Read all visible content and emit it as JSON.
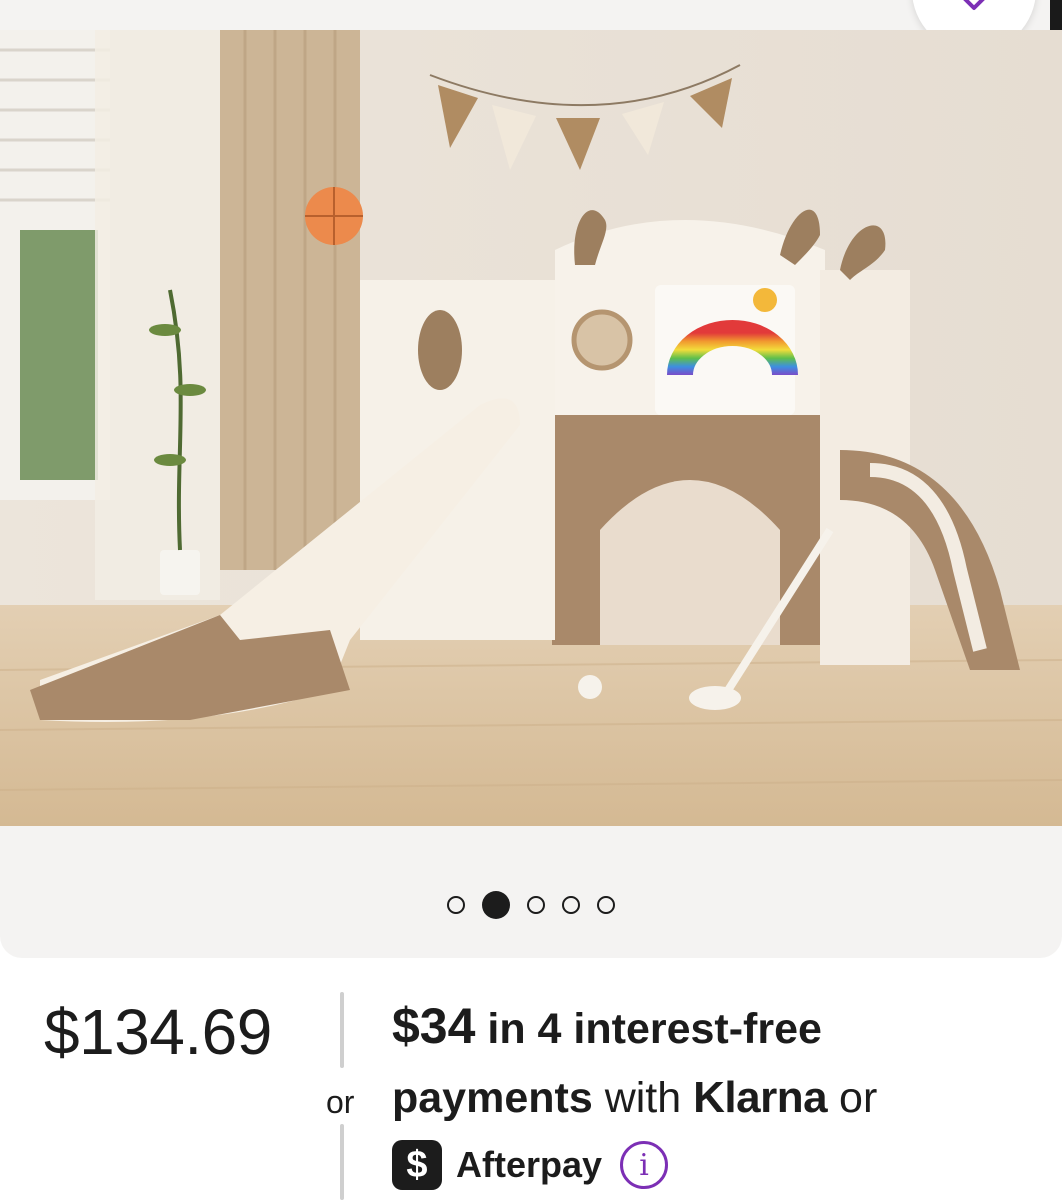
{
  "gallery": {
    "image_alt": "Children's playset with slide, rainbow board, golf club and basketball hoop",
    "dots": [
      {
        "active": false
      },
      {
        "active": true
      },
      {
        "active": false
      },
      {
        "active": false
      },
      {
        "active": false
      }
    ],
    "favorite_icon": "heart-icon"
  },
  "pricing": {
    "price": "$134.69",
    "or_label": "or",
    "installment_amount": "$34",
    "installment_text": " in 4 interest-free",
    "payments_label": "payments",
    "with_label": " with ",
    "klarna_label": "Klarna",
    "or_label_2": " or",
    "afterpay_symbol": "$",
    "afterpay_label": "Afterpay",
    "info_symbol": "i"
  },
  "colors": {
    "accent": "#7c2fb5",
    "text": "#1c1c1c",
    "gallery_bg": "#f4f3f2"
  }
}
